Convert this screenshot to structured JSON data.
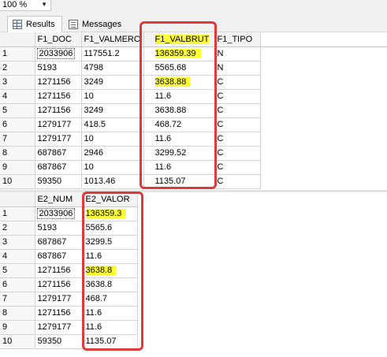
{
  "zoom": {
    "value": "100 %"
  },
  "tabs": {
    "results": "Results",
    "messages": "Messages"
  },
  "grid1": {
    "columns": [
      "F1_DOC",
      "F1_VALMERC",
      "F1_VALBRUT",
      "F1_TIPO"
    ],
    "rows": [
      {
        "n": "1",
        "doc": "2033906",
        "valmerc": "117551.2",
        "valbrut": "136359.39",
        "tipo": "N"
      },
      {
        "n": "2",
        "doc": "5193",
        "valmerc": "4798",
        "valbrut": "5565.68",
        "tipo": "N"
      },
      {
        "n": "3",
        "doc": "1271156",
        "valmerc": "3249",
        "valbrut": "3638.88",
        "tipo": "C"
      },
      {
        "n": "4",
        "doc": "1271156",
        "valmerc": "10",
        "valbrut": "11.6",
        "tipo": "C"
      },
      {
        "n": "5",
        "doc": "1271156",
        "valmerc": "3249",
        "valbrut": "3638.88",
        "tipo": "C"
      },
      {
        "n": "6",
        "doc": "1279177",
        "valmerc": "418.5",
        "valbrut": "468.72",
        "tipo": "C"
      },
      {
        "n": "7",
        "doc": "1279177",
        "valmerc": "10",
        "valbrut": "11.6",
        "tipo": "C"
      },
      {
        "n": "8",
        "doc": "687867",
        "valmerc": "2946",
        "valbrut": "3299.52",
        "tipo": "C"
      },
      {
        "n": "9",
        "doc": "687867",
        "valmerc": "10",
        "valbrut": "11.6",
        "tipo": "C"
      },
      {
        "n": "10",
        "doc": "59350",
        "valmerc": "1013.46",
        "valbrut": "1135.07",
        "tipo": "C"
      }
    ]
  },
  "grid2": {
    "columns": [
      "E2_NUM",
      "E2_VALOR"
    ],
    "rows": [
      {
        "n": "1",
        "num": "2033906",
        "valor": "136359.3"
      },
      {
        "n": "2",
        "num": "5193",
        "valor": "5565.6"
      },
      {
        "n": "3",
        "num": "687867",
        "valor": "3299.5"
      },
      {
        "n": "4",
        "num": "687867",
        "valor": "11.6"
      },
      {
        "n": "5",
        "num": "1271156",
        "valor": "3638.8"
      },
      {
        "n": "6",
        "num": "1271156",
        "valor": "3638.8"
      },
      {
        "n": "7",
        "num": "1279177",
        "valor": "468.7"
      },
      {
        "n": "8",
        "num": "1271156",
        "valor": "11.6"
      },
      {
        "n": "9",
        "num": "1279177",
        "valor": "11.6"
      },
      {
        "n": "10",
        "num": "59350",
        "valor": "1135.07"
      }
    ]
  },
  "colors": {
    "highlight": "#ffff33",
    "annotation_box": "#e0393c"
  }
}
